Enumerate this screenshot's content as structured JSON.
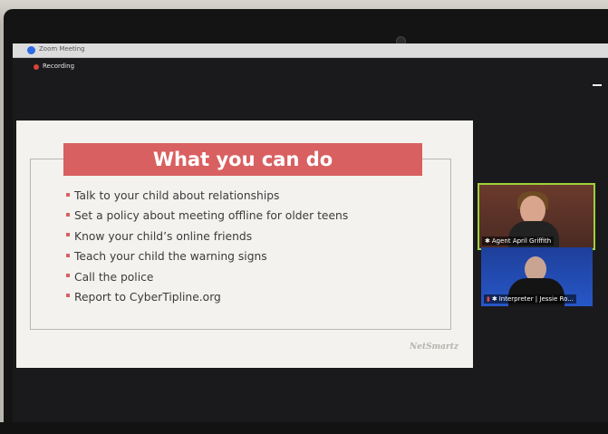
{
  "window": {
    "title": "Zoom Meeting"
  },
  "recording": {
    "label": "Recording"
  },
  "slide": {
    "title": "What you can do",
    "bullets": [
      "Talk to your child about relationships",
      "Set a policy about meeting offline for older teens",
      "Know your child’s online friends",
      "Teach your child the warning signs",
      "Call the police",
      "Report to CyberTipline.org"
    ],
    "logo": "NetSmartz"
  },
  "participants": [
    {
      "name": "Agent April Griffith",
      "active_speaker": true
    },
    {
      "name": "Interpreter | Jessie Ro...",
      "muted": true
    }
  ],
  "colors": {
    "banner": "#d96061",
    "active_speaker_border": "#9fd13c",
    "recording": "#d9433b"
  }
}
